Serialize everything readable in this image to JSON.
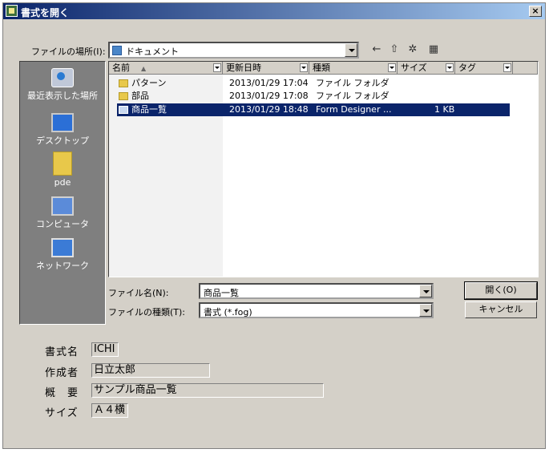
{
  "window": {
    "title": "書式を開く",
    "close_label": "×"
  },
  "location": {
    "label": "ファイルの場所(I):",
    "value": "ドキュメント"
  },
  "toolbar": {
    "back": "←",
    "up": "⇧",
    "new_folder": "✲",
    "views": "▦"
  },
  "places": [
    {
      "label": "最近表示した場所",
      "icon": "recent-places-icon"
    },
    {
      "label": "デスクトップ",
      "icon": "desktop-icon"
    },
    {
      "label": "pde",
      "icon": "user-folder-icon"
    },
    {
      "label": "コンピュータ",
      "icon": "computer-icon"
    },
    {
      "label": "ネットワーク",
      "icon": "network-icon"
    }
  ],
  "columns": [
    "名前",
    "更新日時",
    "種類",
    "サイズ",
    "タグ"
  ],
  "files": [
    {
      "name": "パターン",
      "date": "2013/01/29 17:04",
      "type": "ファイル フォルダ",
      "size": "",
      "kind": "folder"
    },
    {
      "name": "部品",
      "date": "2013/01/29 17:08",
      "type": "ファイル フォルダ",
      "size": "",
      "kind": "folder"
    },
    {
      "name": "商品一覧",
      "date": "2013/01/29 18:48",
      "type": "Form Designer ...",
      "size": "1 KB",
      "kind": "file",
      "selected": true
    }
  ],
  "filename": {
    "label": "ファイル名(N):",
    "value": "商品一覧"
  },
  "filetype": {
    "label": "ファイルの種類(T):",
    "value": "書式 (*.fog)"
  },
  "buttons": {
    "open": "開く(O)",
    "cancel": "キャンセル"
  },
  "info": {
    "name_label": "書式名",
    "name_value": "ICHI",
    "author_label": "作成者",
    "author_value": "日立太郎",
    "summary_label": "概　要",
    "summary_value": "サンプル商品一覧",
    "size_label": "サイズ",
    "size_value": "Ａ４横"
  }
}
